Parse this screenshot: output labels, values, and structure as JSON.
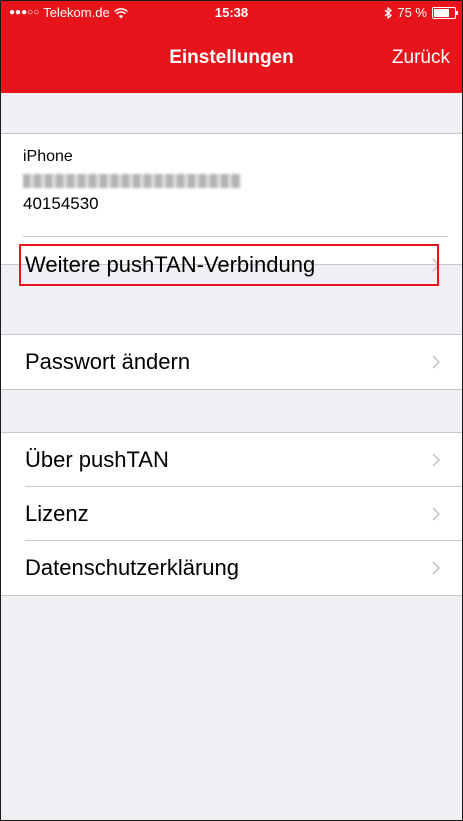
{
  "status_bar": {
    "signal_dots": "●●●○○",
    "carrier": "Telekom.de",
    "wifi_icon": "wifi-icon",
    "time": "15:38",
    "bluetooth_icon": "bluetooth-icon",
    "battery_text": "75 %",
    "battery_level": 0.75
  },
  "navbar": {
    "title": "Einstellungen",
    "back_label": "Zurück"
  },
  "device": {
    "name": "iPhone",
    "blurred_id": "04221703879080248-49",
    "number": "40154530"
  },
  "menu": {
    "add_connection": "Weitere pushTAN-Verbindung",
    "change_password": "Passwort ändern",
    "about": "Über pushTAN",
    "license": "Lizenz",
    "privacy": "Datenschutzerklärung"
  },
  "colors": {
    "accent": "#e8141b",
    "background": "#efeff4",
    "separator": "#c8c7cc"
  }
}
